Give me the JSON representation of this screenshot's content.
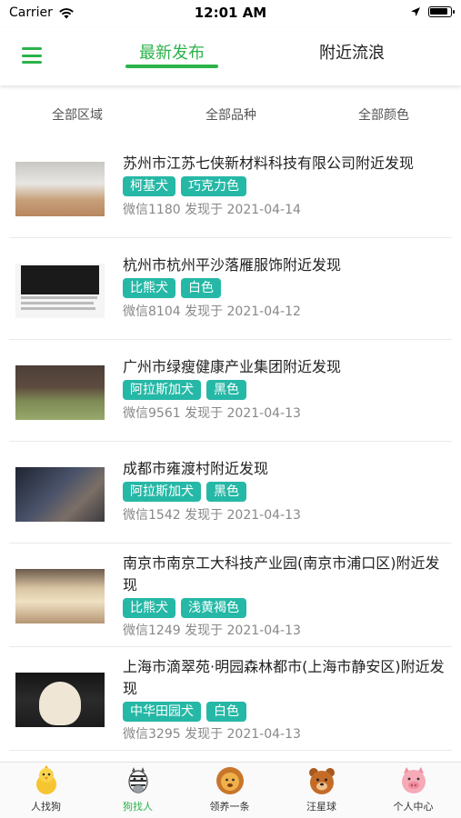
{
  "status_bar": {
    "carrier": "Carrier",
    "time": "12:01 AM"
  },
  "nav": {
    "tabs": [
      {
        "label": "最新发布",
        "active": true
      },
      {
        "label": "附近流浪",
        "active": false
      }
    ],
    "accent_color": "#2bb34a"
  },
  "filters": {
    "area": "全部区域",
    "breed": "全部品种",
    "color": "全部颜色"
  },
  "items": [
    {
      "title": "苏州市江苏七侠新材料科技有限公司附近发现",
      "tags": [
        "柯基犬",
        "巧克力色"
      ],
      "meta": "微信1180 发现于 2021-04-14"
    },
    {
      "title": "杭州市杭州平沙落雁服饰附近发现",
      "tags": [
        "比熊犬",
        "白色"
      ],
      "meta": "微信8104 发现于 2021-04-12"
    },
    {
      "title": "广州市绿瘦健康产业集团附近发现",
      "tags": [
        "阿拉斯加犬",
        "黑色"
      ],
      "meta": "微信9561 发现于 2021-04-13"
    },
    {
      "title": "成都市雍渡村附近发现",
      "tags": [
        "阿拉斯加犬",
        "黑色"
      ],
      "meta": "微信1542 发现于 2021-04-13"
    },
    {
      "title": "南京市南京工大科技产业园(南京市浦口区)附近发现",
      "tags": [
        "比熊犬",
        "浅黄褐色"
      ],
      "meta": "微信1249 发现于 2021-04-13"
    },
    {
      "title": "上海市滴翠苑·明园森林都市(上海市静安区)附近发现",
      "tags": [
        "中华田园犬",
        "白色"
      ],
      "meta": "微信3295 发现于 2021-04-13"
    }
  ],
  "tag_color": "#26b8a6",
  "tab_bar": [
    {
      "label": "人找狗",
      "icon": "chick-icon",
      "active": false
    },
    {
      "label": "狗找人",
      "icon": "zebra-icon",
      "active": true
    },
    {
      "label": "领养一条",
      "icon": "lion-icon",
      "active": false
    },
    {
      "label": "汪星球",
      "icon": "bear-icon",
      "active": false
    },
    {
      "label": "个人中心",
      "icon": "pig-icon",
      "active": false
    }
  ]
}
